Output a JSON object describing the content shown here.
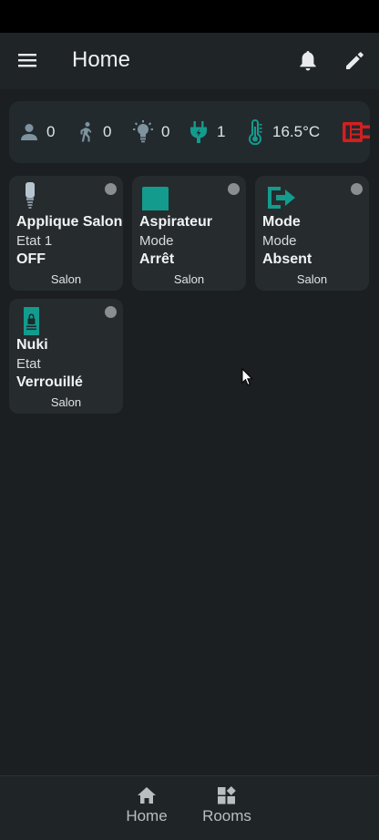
{
  "app_bar": {
    "title": "Home"
  },
  "summary": [
    {
      "icon": "person-icon",
      "value": "0"
    },
    {
      "icon": "walk-icon",
      "value": "0"
    },
    {
      "icon": "lightbulb-icon",
      "value": "0"
    },
    {
      "icon": "plug-icon",
      "value": "1"
    },
    {
      "icon": "thermometer-icon",
      "value": "16.5°C"
    },
    {
      "icon": "heater-icon",
      "value": ""
    }
  ],
  "cards": [
    {
      "name": "Applique Salon",
      "sub": "Etat 1",
      "state": "OFF",
      "room": "Salon",
      "icon": "wall-lamp-icon"
    },
    {
      "name": "Aspirateur",
      "sub": "Mode",
      "state": "Arrêt",
      "room": "Salon",
      "icon": "square-icon"
    },
    {
      "name": "Mode",
      "sub": "Mode",
      "state": "Absent",
      "room": "Salon",
      "icon": "exit-icon"
    },
    {
      "name": "Nuki",
      "sub": "Etat",
      "state": "Verrouillé",
      "room": "Salon",
      "icon": "lock-icon"
    }
  ],
  "bottom_nav": [
    {
      "label": "Home",
      "icon": "home-icon"
    },
    {
      "label": "Rooms",
      "icon": "rooms-icon"
    }
  ],
  "colors": {
    "accent": "#139b8d",
    "alert": "#d31f1f",
    "muted_icon": "#7e93a0"
  }
}
